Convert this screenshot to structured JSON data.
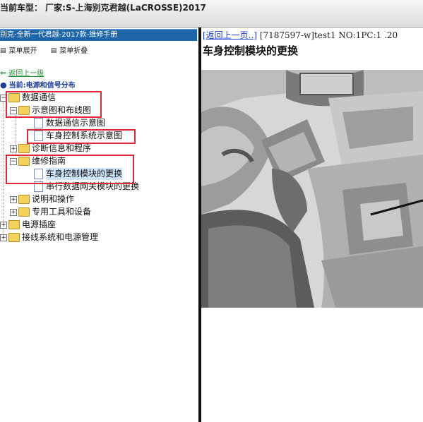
{
  "window": {
    "title": "当前车型： 厂家:S-上海别克君越(LaCROSSE)2017"
  },
  "left_panel": {
    "manual_title": "别克-全新一代君越-2017款-维修手册",
    "toolbar": {
      "expand": "菜单展开",
      "collapse": "菜单折叠"
    },
    "back_link": "返回上一级",
    "current_location": "当前:电源和信号分布",
    "tree": {
      "data_comm": "数据通信",
      "schematics": "示意图和布线图",
      "data_comm_schematic": "数据通信示意图",
      "bcm_schematic": "车身控制系统示意图",
      "diag_info": "诊断信息和程序",
      "repair_guide": "维修指南",
      "bcm_replace": "车身控制模块的更换",
      "serial_gateway_replace": "串行数据网关模块的更换",
      "description": "说明和操作",
      "special_tools": "专用工具和设备",
      "power_outlet": "电源插座",
      "wiring_power": "接线系统和电源管理"
    }
  },
  "right_panel": {
    "back_link": "[返回上一页..]",
    "doc_info": " [7187597-w]test1 NO:1PC:1 .20",
    "page_title": "车身控制模块的更换"
  },
  "colors": {
    "highlight_box": "#e0283a",
    "title_bar": "#1f66a8",
    "link": "#1a3cc6"
  },
  "icons": [
    "folder-icon",
    "document-icon",
    "expand-icon",
    "collapse-icon",
    "back-arrow-icon",
    "location-icon"
  ]
}
